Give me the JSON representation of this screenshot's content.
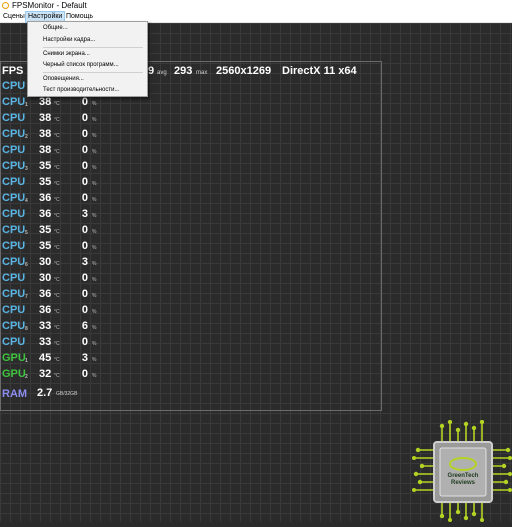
{
  "window": {
    "title": "FPSMonitor - Default"
  },
  "menubar": {
    "items": [
      "Сцены",
      "Настройки",
      "Помощь"
    ],
    "active": "Настройки"
  },
  "dropdown": {
    "items": [
      "Общие...",
      "Настройки кадра...",
      "Снимки экрана...",
      "Черный список программ...",
      "Оповещения...",
      "Тест производительности..."
    ]
  },
  "fps_row": {
    "label": "FPS",
    "avg_value": "9",
    "avg_label": "avg",
    "max_value": "293",
    "max_label": "max",
    "resolution": "2560x1269",
    "api": "DirectX 11 x64"
  },
  "units": {
    "temp": "°C",
    "load": "%"
  },
  "sensors": [
    {
      "label": "CPU",
      "index": "",
      "temp": "",
      "load": "",
      "color": "#5ab4e6"
    },
    {
      "label": "CPU",
      "index": "1",
      "temp": "38",
      "load": "0",
      "color": "#5ab4e6"
    },
    {
      "label": "CPU",
      "index": "",
      "temp": "38",
      "load": "0",
      "color": "#5ab4e6"
    },
    {
      "label": "CPU",
      "index": "2",
      "temp": "38",
      "load": "0",
      "color": "#5ab4e6"
    },
    {
      "label": "CPU",
      "index": "",
      "temp": "38",
      "load": "0",
      "color": "#5ab4e6"
    },
    {
      "label": "CPU",
      "index": "3",
      "temp": "35",
      "load": "0",
      "color": "#5ab4e6"
    },
    {
      "label": "CPU",
      "index": "",
      "temp": "35",
      "load": "0",
      "color": "#5ab4e6"
    },
    {
      "label": "CPU",
      "index": "4",
      "temp": "36",
      "load": "0",
      "color": "#5ab4e6"
    },
    {
      "label": "CPU",
      "index": "",
      "temp": "36",
      "load": "3",
      "color": "#5ab4e6"
    },
    {
      "label": "CPU",
      "index": "5",
      "temp": "35",
      "load": "0",
      "color": "#5ab4e6"
    },
    {
      "label": "CPU",
      "index": "",
      "temp": "35",
      "load": "0",
      "color": "#5ab4e6"
    },
    {
      "label": "CPU",
      "index": "6",
      "temp": "30",
      "load": "3",
      "color": "#5ab4e6"
    },
    {
      "label": "CPU",
      "index": "",
      "temp": "30",
      "load": "0",
      "color": "#5ab4e6"
    },
    {
      "label": "CPU",
      "index": "7",
      "temp": "36",
      "load": "0",
      "color": "#5ab4e6"
    },
    {
      "label": "CPU",
      "index": "",
      "temp": "36",
      "load": "0",
      "color": "#5ab4e6"
    },
    {
      "label": "CPU",
      "index": "8",
      "temp": "33",
      "load": "6",
      "color": "#5ab4e6"
    },
    {
      "label": "CPU",
      "index": "",
      "temp": "33",
      "load": "0",
      "color": "#5ab4e6"
    },
    {
      "label": "GPU",
      "index": "1",
      "temp": "45",
      "load": "3",
      "color": "#3ec43e"
    },
    {
      "label": "GPU",
      "index": "2",
      "temp": "32",
      "load": "0",
      "color": "#3ec43e"
    }
  ],
  "ram": {
    "label": "RAM",
    "value": "2.7",
    "unit": "GB/32GB",
    "color": "#8c8cf0"
  },
  "logo": {
    "line1": "GreenTech",
    "line2": "Reviews"
  },
  "colors": {
    "accent_cpu": "#5ab4e6",
    "accent_gpu": "#3ec43e",
    "accent_ram": "#8c8cf0",
    "logo_green": "#b4d422"
  }
}
